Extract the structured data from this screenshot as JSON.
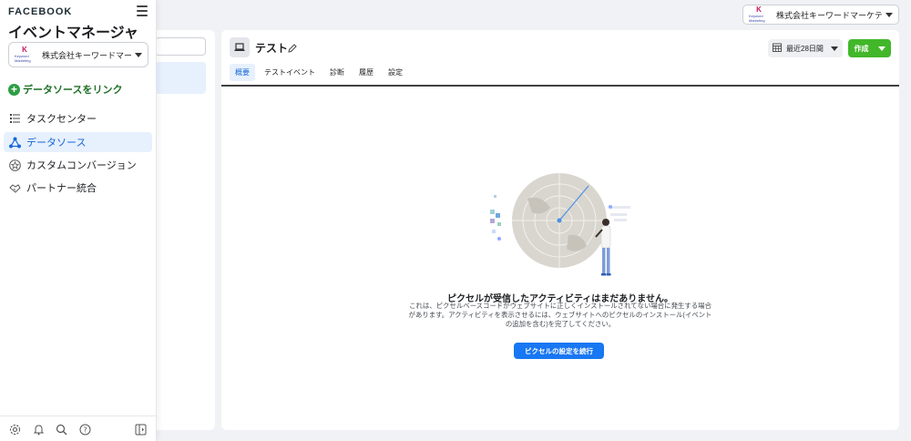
{
  "sidebar": {
    "brand": "FACEBOOK",
    "app_title": "イベントマネージャ",
    "account": {
      "name": "株式会社キーワードマー...",
      "logo_mark": "K",
      "logo_text": "Keyword Marketing"
    },
    "link_source_label": "データソースをリンク",
    "items": [
      {
        "label": "タスクセンター",
        "icon": "list-icon",
        "active": false
      },
      {
        "label": "データソース",
        "icon": "data-source-icon",
        "active": true
      },
      {
        "label": "カスタムコンバージョン",
        "icon": "star-badge-icon",
        "active": false
      },
      {
        "label": "パートナー統合",
        "icon": "handshake-icon",
        "active": false
      }
    ],
    "bottom_icons": [
      "gear-icon",
      "bell-icon",
      "search-icon",
      "help-icon",
      "panel-toggle-icon"
    ]
  },
  "top_account": {
    "name": "株式会社キーワードマーケティ..."
  },
  "main": {
    "pixel_title": "テスト",
    "date_range_label": "最近28日間",
    "create_label": "作成",
    "tabs": [
      {
        "label": "概要",
        "active": true
      },
      {
        "label": "テストイベント",
        "active": false
      },
      {
        "label": "診断",
        "active": false
      },
      {
        "label": "履歴",
        "active": false
      },
      {
        "label": "設定",
        "active": false
      }
    ],
    "empty_state": {
      "title": "ピクセルが受信したアクティビティはまだありません。",
      "line1": "これは、ピクセルベースコードがウェブサイトに正しくインストールされてない場合に発生する場合",
      "line2": "があります。アクティビティを表示させるには、ウェブサイトへのピクセルのインストール(イベント",
      "line3": "の追加を含む)を完了してください。",
      "cta_label": "ピクセルの設定を続行"
    }
  },
  "colors": {
    "accent_blue": "#1877f2",
    "create_green": "#42b72a",
    "link_green": "#2e9e44",
    "active_bg": "#e7f0fd"
  }
}
